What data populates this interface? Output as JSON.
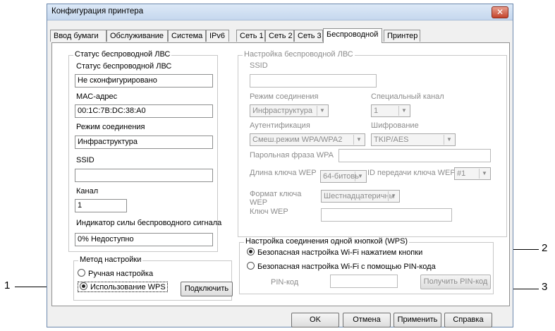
{
  "window": {
    "title": "Конфигурация принтера",
    "close_symbol": "✕"
  },
  "tabs": [
    "Ввод бумаги",
    "Обслуживание",
    "Система",
    "IPv6",
    "Сеть 1",
    "Сеть 2",
    "Сеть 3",
    "Беспроводной",
    "Принтер"
  ],
  "status": {
    "group_label": "Статус беспроводной ЛВС",
    "status_label": "Статус беспроводной ЛВС",
    "status_value": "Не сконфигурировано",
    "mac_label": "МАС-адрес",
    "mac_value": "00:1C:7B:DC:38:A0",
    "mode_label": "Режим соединения",
    "mode_value": "Инфраструктура",
    "ssid_label": "SSID",
    "ssid_value": "",
    "channel_label": "Канал",
    "channel_value": "1",
    "signal_label": "Индикатор силы беспроводного сигнала",
    "signal_value": "0% Недоступно"
  },
  "method": {
    "group_label": "Метод настройки",
    "manual": "Ручная настройка",
    "wps": "Использование WPS",
    "connect_button": "Подключить"
  },
  "wlan": {
    "group_label": "Настройка беспроводной ЛВС",
    "ssid_label": "SSID",
    "mode_label": "Режим соединения",
    "mode_value": "Инфраструктура",
    "channel_label": "Специальный канал",
    "channel_value": "1",
    "auth_label": "Аутентификация",
    "auth_value": "Смеш.режим WPA/WPA2",
    "enc_label": "Шифрование",
    "enc_value": "TKIP/AES",
    "passphrase_label": "Парольная фраза WPA",
    "wep_len_label": "Длина ключа WEP",
    "wep_len_value": "64-битовь",
    "wep_id_label": "ID передачи ключа WEP",
    "wep_id_value": "#1",
    "key_format_label": "Формат ключа WEP",
    "key_format_value": "Шестнадцатеричны",
    "wep_key_label": "Ключ WEP"
  },
  "wps": {
    "group_label": "Настройка соединения одной кнопкой (WPS)",
    "push_button": "Безопасная настройка Wi-Fi нажатием кнопки",
    "pin_option": "Безопасная настройка Wi-Fi с помощью PIN-кода",
    "pin_label": "PIN-код",
    "get_pin_button": "Получить PIN-код"
  },
  "footer": {
    "ok": "OK",
    "cancel": "Отмена",
    "apply": "Применить",
    "help": "Справка"
  },
  "callouts": {
    "one": "1",
    "two": "2",
    "three": "3"
  }
}
